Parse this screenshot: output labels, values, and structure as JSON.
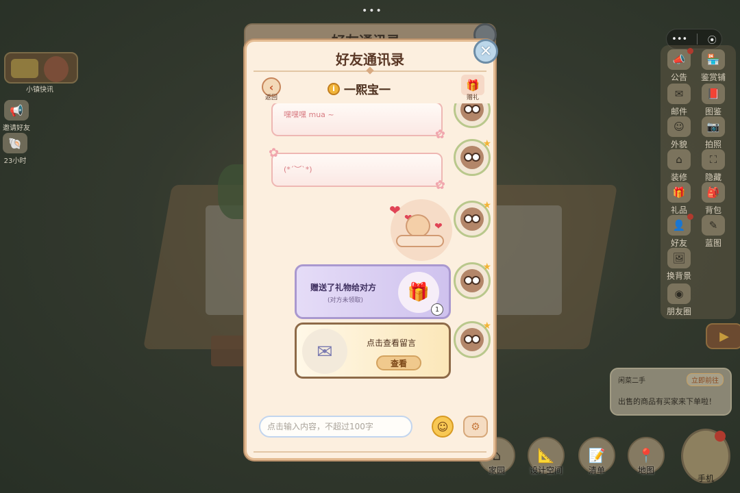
{
  "window": {
    "title": "好友通讯录"
  },
  "modal": {
    "title": "好友通讯录",
    "back_label": "返回",
    "friend_name": "一熙宝一",
    "gift_label": "赠礼",
    "close_icon": "close-icon"
  },
  "chat": {
    "messages": [
      {
        "type": "text",
        "text": "嘿嘿嘿 mua ~"
      },
      {
        "type": "text",
        "text": "(*´︶`*)"
      },
      {
        "type": "sticker",
        "name": "snail-hearts-sticker"
      },
      {
        "type": "gift",
        "title": "赠送了礼物给对方",
        "subtitle": "(对方未领取)",
        "count": "1"
      },
      {
        "type": "message",
        "title": "点击查看留言",
        "button": "查看"
      }
    ],
    "input_placeholder": "点击输入内容，不超过100字"
  },
  "background": {
    "top_dots": "•••",
    "capsule": {
      "more": "•••",
      "record": "⦿"
    },
    "left_features": [
      {
        "label": "小镇快讯"
      },
      {
        "label": "邀请好友"
      },
      {
        "label": "23小时"
      }
    ],
    "right_features": [
      {
        "label": "公告"
      },
      {
        "label": "鉴赏铺"
      },
      {
        "label": "邮件"
      },
      {
        "label": "图鉴"
      },
      {
        "label": "外貌"
      },
      {
        "label": "拍照"
      },
      {
        "label": "装修"
      },
      {
        "label": "隐藏"
      },
      {
        "label": "礼品"
      },
      {
        "label": "背包"
      },
      {
        "label": "好友"
      },
      {
        "label": "蓝图"
      },
      {
        "label": "换背景"
      },
      {
        "label": "朋友圈"
      }
    ],
    "notice": {
      "title": "闲菜二手",
      "action": "立即前往",
      "message": "出售的商品有买家来下单啦！"
    },
    "bottom_nav": [
      {
        "label": "家园"
      },
      {
        "label": "设计空间"
      },
      {
        "label": "清单"
      },
      {
        "label": "地图"
      }
    ],
    "phone_label": "手机"
  }
}
